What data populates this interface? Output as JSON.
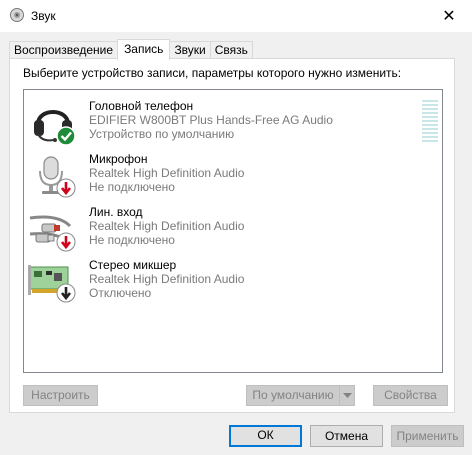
{
  "window": {
    "title": "Звук",
    "close_glyph": "✕"
  },
  "tabs": [
    {
      "label": "Воспроизведение",
      "active": false
    },
    {
      "label": "Запись",
      "active": true
    },
    {
      "label": "Звуки",
      "active": false
    },
    {
      "label": "Связь",
      "active": false
    }
  ],
  "instruction": "Выберите устройство записи, параметры которого нужно изменить:",
  "devices": [
    {
      "name": "Головной телефон",
      "driver": "EDIFIER W800BT Plus Hands-Free AG Audio",
      "status": "Устройство по умолчанию",
      "icon": "headset-icon",
      "badge": "default-check-badge-icon",
      "badge_color": "#1e8a3a"
    },
    {
      "name": "Микрофон",
      "driver": "Realtek High Definition Audio",
      "status": "Не подключено",
      "icon": "microphone-icon",
      "badge": "disconnected-arrow-badge-icon",
      "badge_color": "#d0021b"
    },
    {
      "name": "Лин. вход",
      "driver": "Realtek High Definition Audio",
      "status": "Не подключено",
      "icon": "line-in-cable-icon",
      "badge": "disconnected-arrow-badge-icon",
      "badge_color": "#d0021b"
    },
    {
      "name": "Стерео микшер",
      "driver": "Realtek High Definition Audio",
      "status": "Отключено",
      "icon": "sound-card-icon",
      "badge": "disabled-arrow-badge-icon",
      "badge_color": "#222222"
    }
  ],
  "buttons": {
    "configure": "Настроить",
    "set_default": "По умолчанию",
    "properties": "Свойства",
    "ok": "ОК",
    "cancel": "Отмена",
    "apply": "Применить"
  },
  "colors": {
    "accent": "#0078d7",
    "disabled_text": "#838383"
  }
}
